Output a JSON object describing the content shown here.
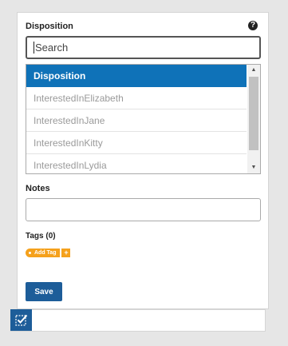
{
  "disposition": {
    "label": "Disposition",
    "help_icon": "question-circle-icon",
    "help_glyph": "?",
    "search_placeholder": "Search",
    "options": [
      {
        "label": "Disposition",
        "selected": true
      },
      {
        "label": "InterestedInElizabeth",
        "selected": false
      },
      {
        "label": "InterestedInJane",
        "selected": false
      },
      {
        "label": "InterestedInKitty",
        "selected": false
      },
      {
        "label": "InterestedInLydia",
        "selected": false
      }
    ],
    "scroll_up_glyph": "▲",
    "scroll_down_glyph": "▼"
  },
  "notes": {
    "label": "Notes",
    "value": ""
  },
  "tags": {
    "label": "Tags (0)",
    "add_label": "Add Tag",
    "plus_glyph": "+"
  },
  "save_label": "Save",
  "bottom_bar": {
    "icon": "checkbox-checked-icon"
  },
  "colors": {
    "selected_option": "#0f72b8",
    "save_button": "#1d5d99",
    "tag": "#f5a11c"
  }
}
